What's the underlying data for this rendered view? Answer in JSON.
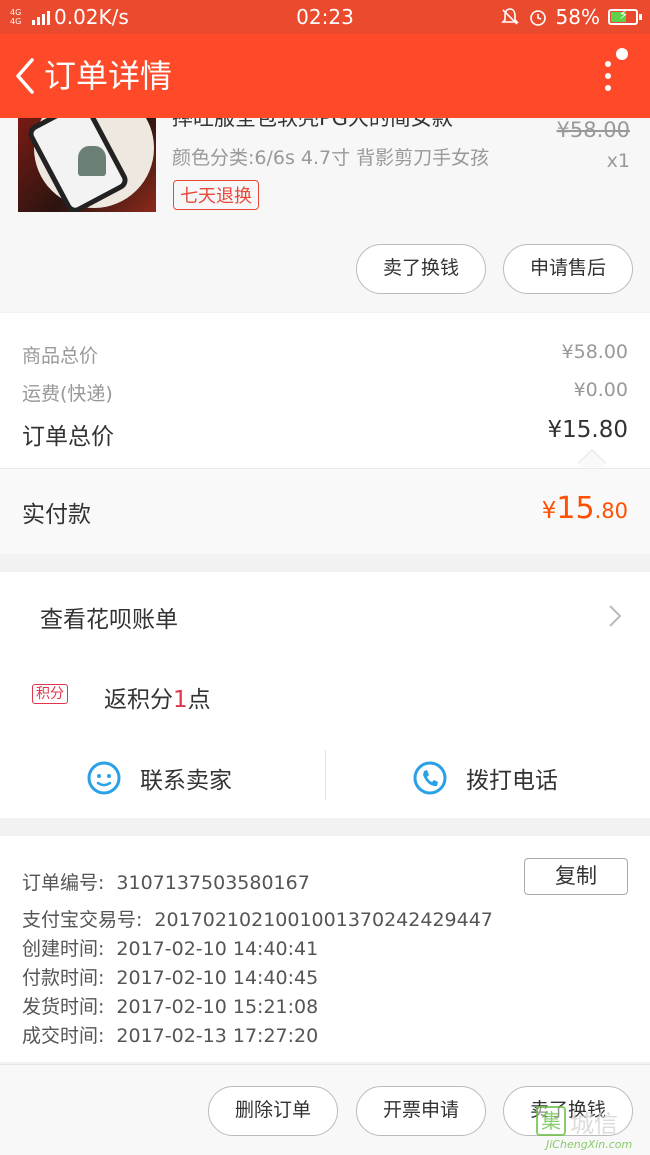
{
  "status_bar": {
    "network": "4G 4G",
    "speed": "0.02K/s",
    "time": "02:23",
    "battery": "58%"
  },
  "header": {
    "title": "订单详情"
  },
  "product": {
    "title": "摔旺服全包软壳PG大的简女款",
    "spec": "颜色分类:6/6s 4.7寸 背影剪刀手女孩",
    "tag": "七天退换",
    "old_price": "¥58.00",
    "qty": "x1",
    "buttons": {
      "sell": "卖了换钱",
      "after_sale": "申请售后"
    }
  },
  "prices": {
    "goods_label": "商品总价",
    "goods_value": "¥58.00",
    "shipping_label": "运费(快递)",
    "shipping_value": "¥0.00",
    "total_label": "订单总价",
    "total_value": "¥15.80"
  },
  "paid": {
    "label": "实付款",
    "currency": "¥",
    "integer": "15",
    "decimal": ".80"
  },
  "services": {
    "huabei": "查看花呗账单",
    "jifen_badge": "积分",
    "jifen_prefix": "返积分",
    "jifen_num": "1",
    "jifen_suffix": "点",
    "contact_seller": "联系卖家",
    "call_phone": "拨打电话"
  },
  "order_info": {
    "copy_label": "复制",
    "lines": [
      {
        "label": "订单编号:",
        "value": "3107137503580167"
      },
      {
        "label": "支付宝交易号:",
        "value": "2017021021001001370242429447"
      },
      {
        "label": "创建时间:",
        "value": "2017-02-10 14:40:41"
      },
      {
        "label": "付款时间:",
        "value": "2017-02-10 14:40:45"
      },
      {
        "label": "发货时间:",
        "value": "2017-02-10 15:21:08"
      },
      {
        "label": "成交时间:",
        "value": "2017-02-13 17:27:20"
      }
    ]
  },
  "bottom_bar": {
    "delete": "删除订单",
    "invoice": "开票申请",
    "sell": "卖了换钱"
  },
  "watermark": {
    "logo": "集",
    "text": "城信",
    "url": "JiChengXin.com"
  },
  "colors": {
    "brand": "#ff4a29",
    "price_accent": "#ff5000",
    "tag_red": "#e7483a",
    "icon_blue": "#2aa1e6"
  }
}
